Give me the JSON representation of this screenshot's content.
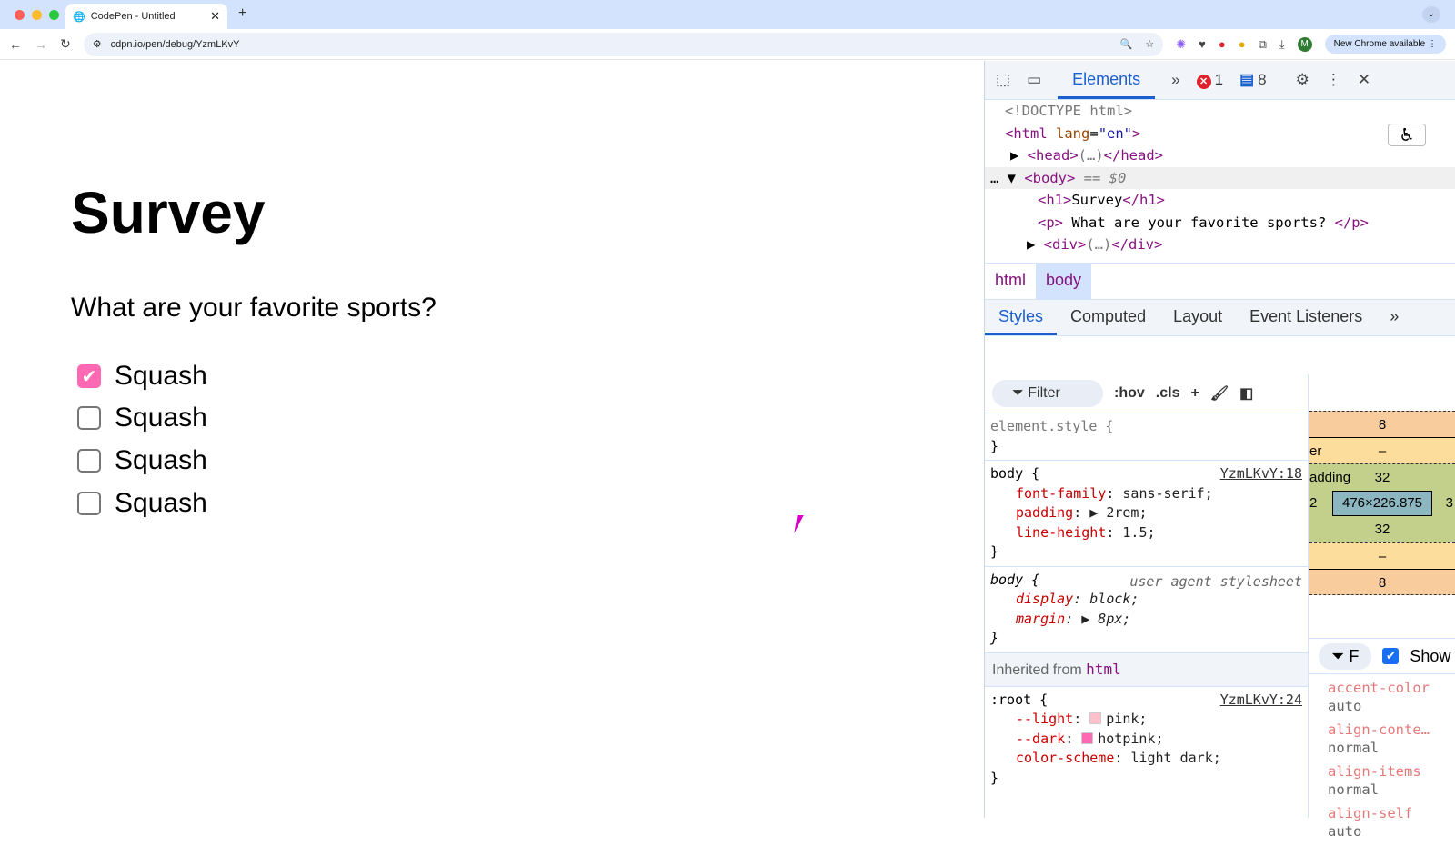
{
  "browser": {
    "tab_title": "CodePen - Untitled",
    "url": "cdpn.io/pen/debug/YzmLKvY",
    "new_chrome": "New Chrome available",
    "profile_initial": "M"
  },
  "page": {
    "title": "Survey",
    "question": "What are your favorite sports?",
    "options": [
      {
        "label": "Squash",
        "checked": true
      },
      {
        "label": "Squash",
        "checked": false
      },
      {
        "label": "Squash",
        "checked": false
      },
      {
        "label": "Squash",
        "checked": false
      }
    ]
  },
  "devtools": {
    "tab": "Elements",
    "errors": "1",
    "messages": "8",
    "dom": {
      "doctype": "<!DOCTYPE html>",
      "html_open": "<html",
      "lang_attr": "lang",
      "lang_val": "\"en\"",
      "head": "<head>",
      "head_close": "</head>",
      "body": "<body>",
      "body_eq": "== $0",
      "h1_open": "<h1>",
      "h1_text": "Survey",
      "h1_close": "</h1>",
      "p_open": "<p>",
      "p_text": " What are your favorite sports? ",
      "p_close": "</p>",
      "div": "<div>",
      "div_close": "</div>"
    },
    "breadcrumbs": [
      "html",
      "body"
    ],
    "style_tabs": [
      "Styles",
      "Computed",
      "Layout",
      "Event Listeners"
    ],
    "filter": "Filter",
    "hov": ":hov",
    "cls": ".cls",
    "rules": {
      "element_style": "element.style {",
      "close": "}",
      "body1_sel": "body {",
      "body1_src": "YzmLKvY:18",
      "body1_props": [
        [
          "font-family",
          "sans-serif"
        ],
        [
          "padding",
          "▶ 2rem"
        ],
        [
          "line-height",
          "1.5"
        ]
      ],
      "body2_sel": "body {",
      "body2_src": "user agent stylesheet",
      "body2_props": [
        [
          "display",
          "block"
        ],
        [
          "margin",
          "▶ 8px"
        ]
      ],
      "inherited_label": "Inherited from",
      "inherited_tag": "html",
      "root_sel": ":root {",
      "root_src": "YzmLKvY:24",
      "root_props": [
        [
          "--light",
          "pink",
          "#ffc0cb"
        ],
        [
          "--dark",
          "hotpink",
          "#ff69b4"
        ],
        [
          "color-scheme",
          "light dark",
          ""
        ]
      ]
    },
    "box_model": {
      "margin_top": "8",
      "border_label": "er",
      "border_top": "–",
      "padding_label": "adding",
      "padding_top": "32",
      "padding_left": "2",
      "padding_right": "3",
      "content": "476×226.875",
      "padding_bottom": "32",
      "border_bottom": "–",
      "margin_bottom": "8"
    },
    "computed_filter": "F",
    "show_all": "Show",
    "computed": [
      [
        "accent-color",
        "auto"
      ],
      [
        "align-conte…",
        "normal"
      ],
      [
        "align-items",
        "normal"
      ],
      [
        "align-self",
        "auto"
      ]
    ]
  }
}
